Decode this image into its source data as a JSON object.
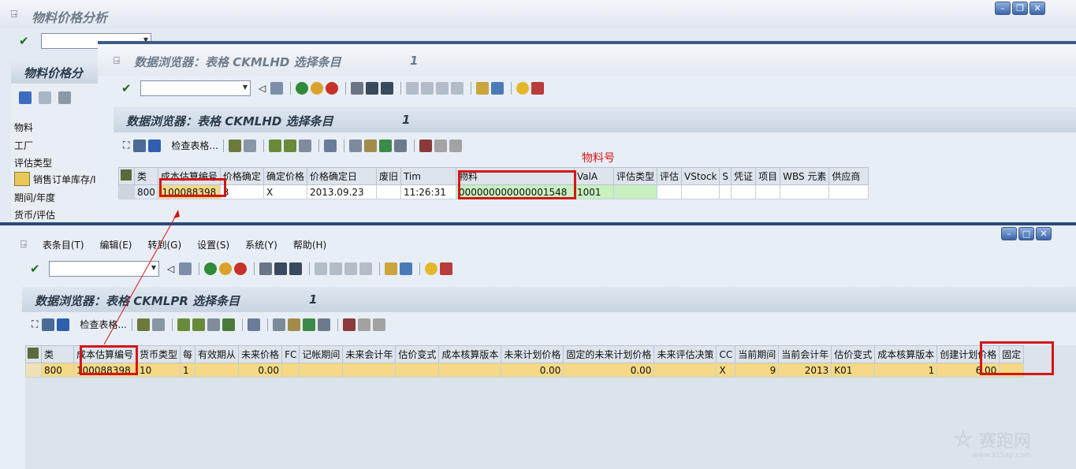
{
  "bg": {
    "title": "物料价格分析",
    "panel_title": "物料价格分",
    "side_items": [
      "物料",
      "工厂",
      "评估类型",
      "销售订单库存/I",
      "期间/年度",
      "货币/评估"
    ]
  },
  "win1": {
    "title": "数据浏览器：表格 CKMLHD 选择条目",
    "title_num": "1",
    "header_title": "数据浏览器：表格 CKMLHD 选择条目",
    "header_num": "1",
    "check_table_label": "检查表格...",
    "columns": [
      "类",
      "成本估算编号",
      "价格确定",
      "确定价格",
      "价格确定日",
      "废旧",
      "Tim",
      "物料",
      "ValA",
      "评估类型",
      "评估",
      "VStock",
      "S",
      "凭证",
      "项目",
      "WBS 元素",
      "供应商"
    ],
    "row": [
      "800",
      "100088398",
      "3",
      "X",
      "2013.09.23",
      "",
      "11:26:31",
      "000000000000001548",
      "1001",
      "",
      "",
      "",
      "",
      "",
      "",
      "",
      ""
    ]
  },
  "annotation": {
    "material_label": "物料号"
  },
  "win2": {
    "menu": [
      "表条目(T)",
      "编辑(E)",
      "转到(G)",
      "设置(S)",
      "系统(Y)",
      "帮助(H)"
    ],
    "header_title": "数据浏览器：表格 CKMLPR 选择条目",
    "header_num": "1",
    "check_table_label": "检查表格...",
    "columns": [
      "类",
      "成本估算编号",
      "货币类型",
      "每",
      "有效期从",
      "未来价格",
      "FC",
      "记帐期间",
      "未来会计年",
      "估价变式",
      "成本核算版本",
      "未来计划价格",
      "固定的未来计划价格",
      "未来评估决策",
      "CC",
      "当前期间",
      "当前会计年",
      "估价变式",
      "成本核算版本",
      "创建计划价格",
      "固定"
    ],
    "row": [
      "800",
      "100088398",
      "10",
      "1",
      "",
      "0.00",
      "",
      "",
      "",
      "",
      "",
      "0.00",
      "0.00",
      "",
      "X",
      "9",
      "2013",
      "K01",
      "1",
      "6.00",
      ""
    ]
  },
  "watermark": {
    "name": "赛跑网",
    "url": "www.91Sap.com"
  },
  "colors": {
    "highlight_red": "#d31616",
    "row_yellow": "#f5d986",
    "green_cell": "#c8f0c0"
  }
}
